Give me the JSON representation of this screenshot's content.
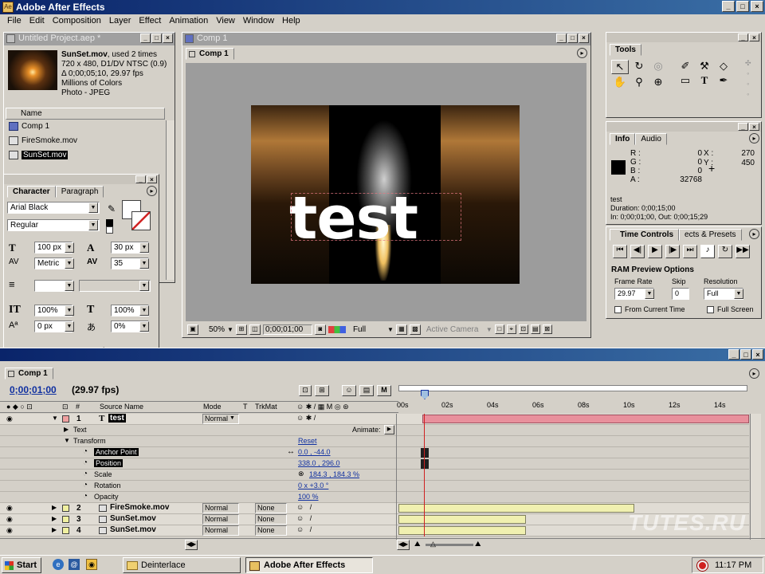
{
  "app": {
    "title": "Adobe After Effects"
  },
  "menu": [
    "File",
    "Edit",
    "Composition",
    "Layer",
    "Effect",
    "Animation",
    "View",
    "Window",
    "Help"
  ],
  "project": {
    "title": "Untitled Project.aep *",
    "thumb_name": "SunSet.mov",
    "thumb_used": ", used 2 times",
    "info_lines": [
      "720 x 480, D1/DV NTSC (0.9)",
      "Δ 0;00;05;10, 29.97 fps",
      "Millions of Colors",
      "Photo - JPEG"
    ],
    "col_name": "Name",
    "items": [
      "Comp 1",
      "FireSmoke.mov",
      "SunSet.mov"
    ]
  },
  "comp_window": {
    "title": "Comp 1",
    "tab": "Comp 1",
    "text_overlay": "test",
    "zoom": "50%",
    "timecode": "0;00;01;00",
    "resolution": "Full",
    "camera": "Active Camera"
  },
  "character": {
    "tab1": "Character",
    "tab2": "Paragraph",
    "font": "Arial Black",
    "style": "Regular",
    "size": "100 px",
    "leading": "30 px",
    "kerning": "Metric",
    "tracking": "35",
    "vscale": "100%",
    "hscale": "100%",
    "baseline": "0 px",
    "tsume": "0%",
    "buttons": [
      "T",
      "T",
      "TT",
      "Tt",
      "T¹",
      "T,"
    ]
  },
  "tools": {
    "title": "Tools"
  },
  "info": {
    "tab1": "Info",
    "tab2": "Audio",
    "r_label": "R :",
    "r": "0",
    "g_label": "G :",
    "g": "0",
    "b_label": "B :",
    "b": "0",
    "a_label": "A :",
    "a": "32768",
    "x_label": "X :",
    "x": "270",
    "y_label": "Y :",
    "y": "450",
    "layer": "test",
    "duration": "Duration: 0;00;15;00",
    "inout": "In: 0;00;01;00, Out: 0;00;15;29"
  },
  "time_controls": {
    "tab1": "Time Controls",
    "tab2": "ects & Presets",
    "ram_title": "RAM Preview Options",
    "frame_rate_label": "Frame Rate",
    "frame_rate": "29.97",
    "skip_label": "Skip",
    "skip": "0",
    "resolution_label": "Resolution",
    "resolution": "Full",
    "from_current": "From Current Time",
    "full_screen": "Full Screen"
  },
  "timeline": {
    "tab": "Comp 1",
    "timecode": "0;00;01;00",
    "fps": "(29.97 fps)",
    "col_hash": "#",
    "col_source": "Source Name",
    "col_mode": "Mode",
    "col_t": "T",
    "col_trkmat": "TrkMat",
    "ruler": [
      "00s",
      "02s",
      "04s",
      "06s",
      "08s",
      "10s",
      "12s",
      "14s"
    ],
    "animate": "Animate:",
    "reset": "Reset",
    "layers": [
      {
        "num": "1",
        "name": "test",
        "mode": "Normal",
        "trkmat": ""
      },
      {
        "num": "2",
        "name": "FireSmoke.mov",
        "mode": "Normal",
        "trkmat": "None"
      },
      {
        "num": "3",
        "name": "SunSet.mov",
        "mode": "Normal",
        "trkmat": "None"
      },
      {
        "num": "4",
        "name": "SunSet.mov",
        "mode": "Normal",
        "trkmat": "None"
      }
    ],
    "props": {
      "text": "Text",
      "transform": "Transform",
      "anchor": "Anchor Point",
      "anchor_val": "0.0 , -44.0",
      "position": "Position",
      "position_val": "338.0 , 296.0",
      "scale": "Scale",
      "scale_val": "184.3 , 184.3 %",
      "rotation": "Rotation",
      "rotation_val": "0 x +3.0 °",
      "opacity": "Opacity",
      "opacity_val": "100 %"
    }
  },
  "watermark": "TUTES.RU",
  "taskbar": {
    "start": "Start",
    "task1": "Deinterlace",
    "task2": "Adobe After Effects",
    "clock": "11:17 PM"
  }
}
